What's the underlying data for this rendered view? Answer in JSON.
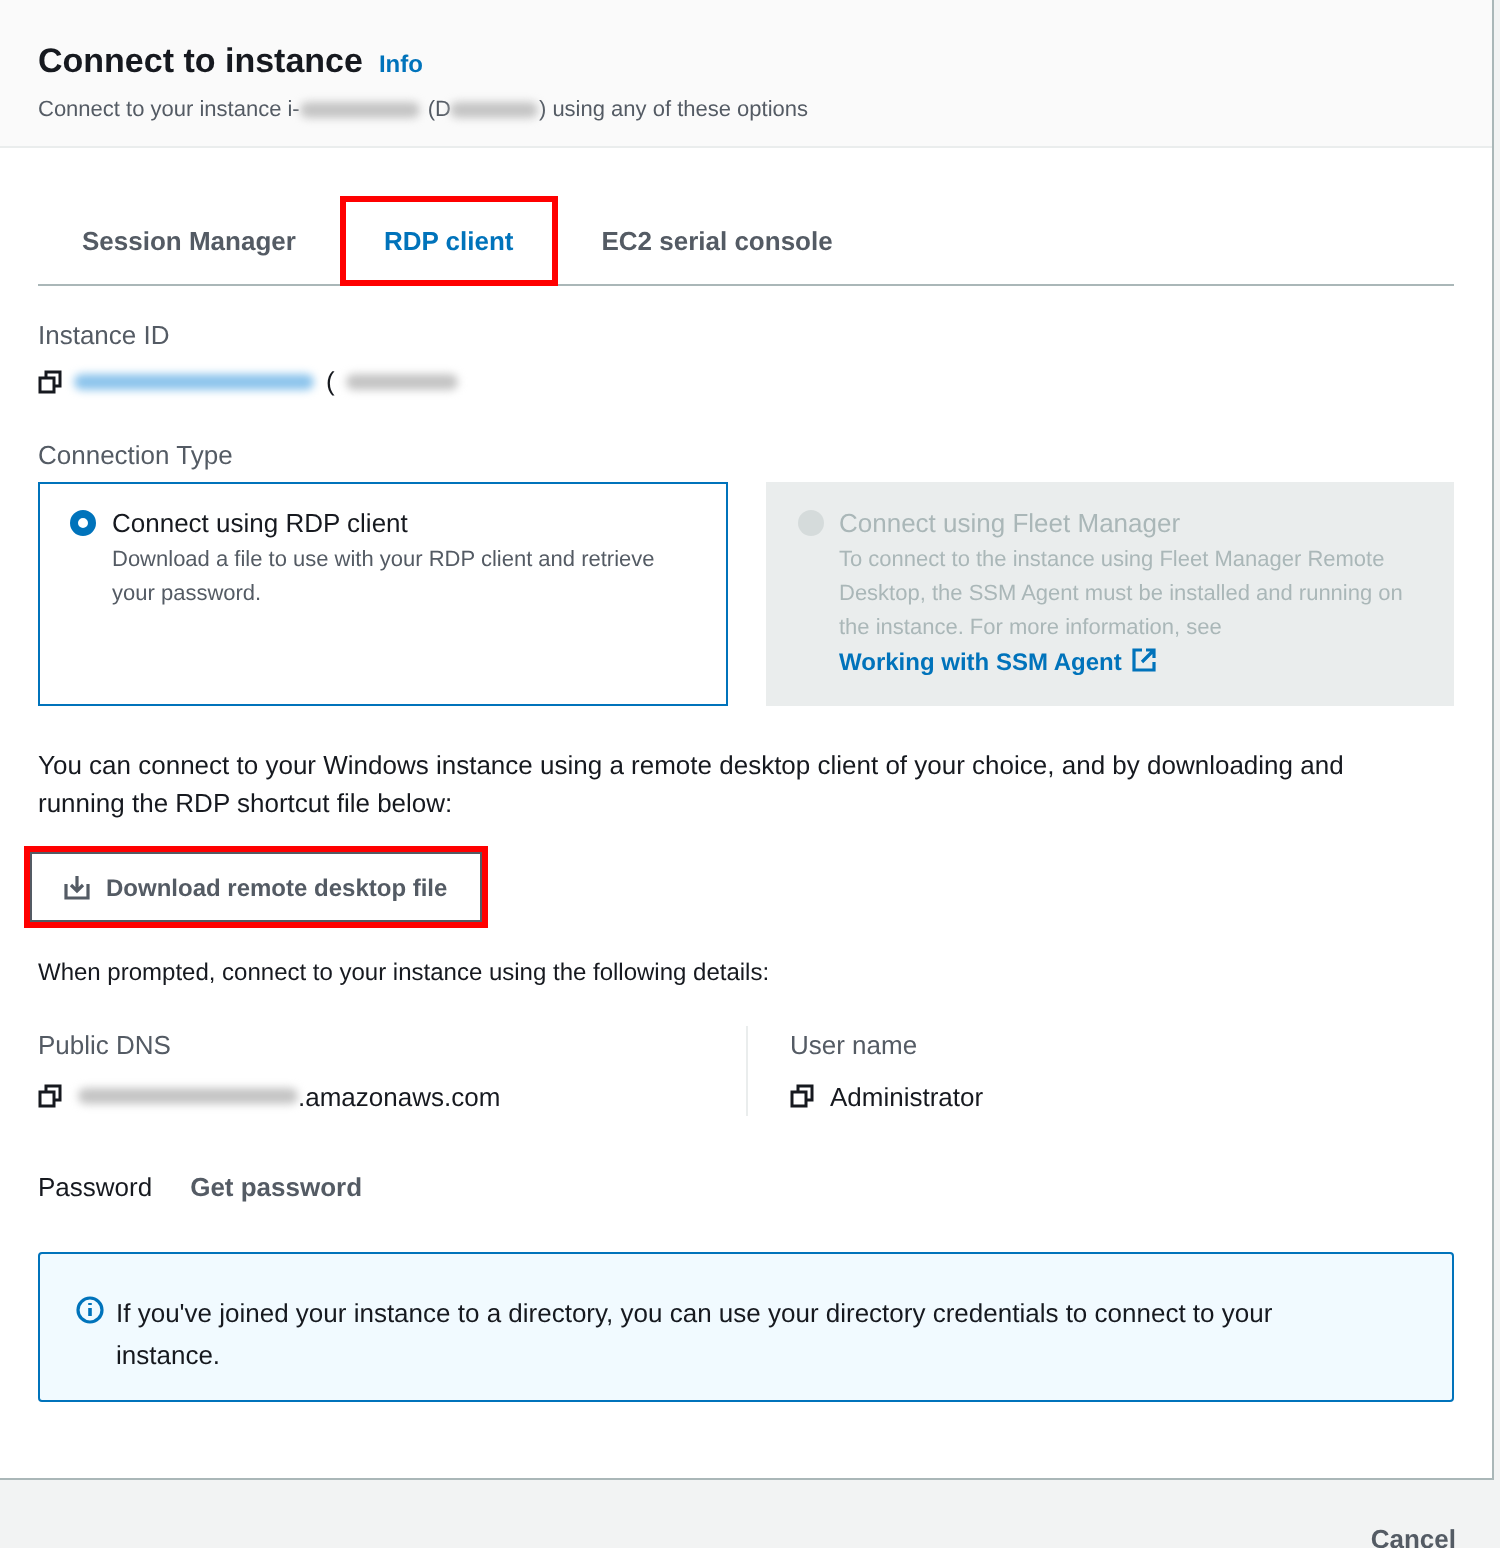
{
  "header": {
    "title": "Connect to instance",
    "info_link": "Info",
    "subtitle_parts": [
      "Connect to your instance i-",
      "(D",
      ") using any of these options"
    ]
  },
  "tabs": [
    {
      "label": "Session Manager",
      "selected": false,
      "highlighted": false
    },
    {
      "label": "RDP client",
      "selected": true,
      "highlighted": true
    },
    {
      "label": "EC2 serial console",
      "selected": false,
      "highlighted": false
    }
  ],
  "instance_id": {
    "label": "Instance ID",
    "parts": [
      "("
    ]
  },
  "connection_type": {
    "label": "Connection Type",
    "options": [
      {
        "title": "Connect using RDP client",
        "description": "Download a file to use with your RDP client and retrieve your password.",
        "selected": true,
        "disabled": false
      },
      {
        "title": "Connect using Fleet Manager",
        "description": "To connect to the instance using Fleet Manager Remote Desktop, the SSM Agent must be installed and running on the instance. For more information, see",
        "link": "Working with SSM Agent",
        "selected": false,
        "disabled": true
      }
    ]
  },
  "intro": "You can connect to your Windows instance using a remote desktop client of your choice, and by downloading and running the RDP shortcut file below:",
  "download_button": {
    "label": "Download remote desktop file",
    "highlighted": true
  },
  "details_intro": "When prompted, connect to your instance using the following details:",
  "public_dns": {
    "label": "Public DNS",
    "value_suffix": ".amazonaws.com"
  },
  "user_name": {
    "label": "User name",
    "value": "Administrator"
  },
  "password": {
    "label": "Password",
    "action": "Get password"
  },
  "info_alert": "If you've joined your instance to a directory, you can use your directory credentials to connect to your instance.",
  "footer": {
    "cancel": "Cancel"
  }
}
